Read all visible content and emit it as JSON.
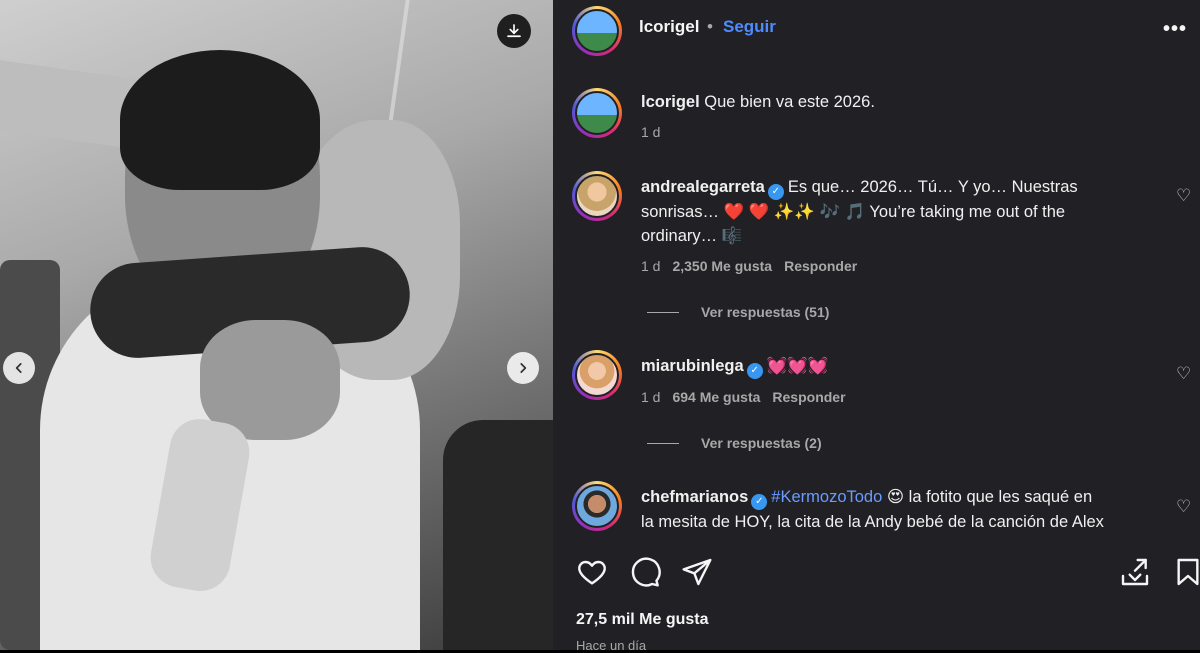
{
  "post": {
    "owner": "lcorigel",
    "follow_label": "Seguir",
    "separator": "•",
    "more_label": "•••"
  },
  "caption": {
    "user": "lcorigel",
    "text": "Que bien va este 2026.",
    "time": "1 d"
  },
  "comments": [
    {
      "user": "andrealegarreta",
      "verified": true,
      "text_line1": "Es que… 2026… Tú… Y yo… Nuestras",
      "text_line2": "sonrisas… ❤️ ❤️ ✨✨ 🎶 🎵 You’re taking me out of the",
      "text_line3": "ordinary… 🎼",
      "time": "1 d",
      "likes": "2,350 Me gusta",
      "reply_label": "Responder",
      "view_replies": "Ver respuestas (51)"
    },
    {
      "user": "miarubinlega",
      "verified": true,
      "text_line1": "💓💓💓",
      "time": "1 d",
      "likes": "694 Me gusta",
      "reply_label": "Responder",
      "view_replies": "Ver respuestas (2)"
    },
    {
      "user": "chefmarianos",
      "verified": true,
      "hashtag": "#KermozoTodo",
      "text_line1": "😍 la fotito que les saqué en",
      "text_line2": "la mesita de HOY, la cita de la Andy bebé de la canción de Alex"
    }
  ],
  "footer": {
    "likes": "27,5 mil Me gusta",
    "time": "Hace un día"
  },
  "icons": {
    "download": "download-icon",
    "prev": "chevron-left-icon",
    "next": "chevron-right-icon",
    "like": "heart-icon",
    "comment": "comment-icon",
    "share": "send-icon",
    "save": "bookmark-icon",
    "save_download": "save-download-icon"
  },
  "colors": {
    "panel_bg": "#212125",
    "link_blue": "#4e8bff",
    "verified_blue": "#3897f0",
    "muted_text": "#a8a8a8"
  }
}
